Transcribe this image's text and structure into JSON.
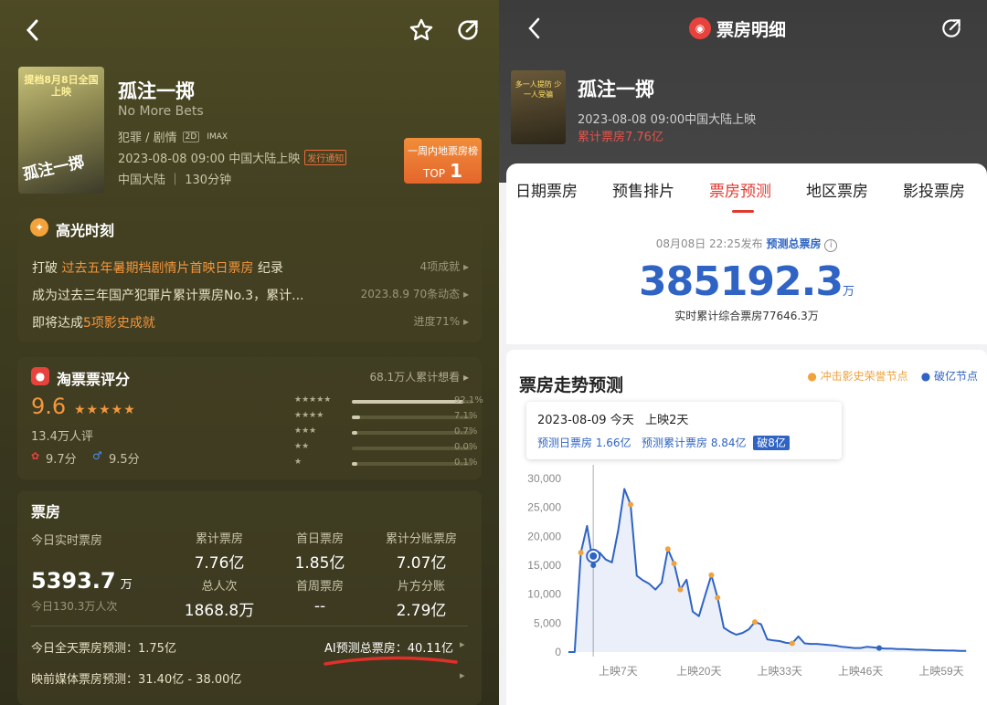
{
  "left": {
    "movie": {
      "title": "孤注一掷",
      "english_title": "No More Bets",
      "genres": "犯罪 / 剧情",
      "format_2d": "2D",
      "format_imax": "IMAX",
      "release": "2023-08-08 09:00 中国大陆上映",
      "release_notice": "发行通知",
      "region_duration": "中国大陆 ｜ 130分钟",
      "poster_text": "提档8月8日全国上映",
      "poster_title": "孤注一掷"
    },
    "rank_badge": {
      "line1": "一周内地票房榜",
      "prefix": "TOP",
      "rank": "1"
    },
    "highlights": {
      "title": "高光时刻",
      "rows": [
        {
          "pre": "打破 ",
          "highlight": "过去五年暑期档剧情片首映日票房",
          "post": " 纪录",
          "right": "4项成就 ▸"
        },
        {
          "pre": "成为过去三年国产犯罪片累计票房No.3，累计...",
          "highlight": "",
          "post": "",
          "right": "2023.8.9 70条动态 ▸"
        },
        {
          "pre": "即将达成",
          "highlight": "5项影史成就",
          "post": "",
          "right": "进度71% ▸"
        }
      ]
    },
    "rating": {
      "title": "淘票票评分",
      "want": "68.1万人累计想看 ▸",
      "score": "9.6",
      "stars": "★★★★★",
      "count": "13.4万人评",
      "sub_rating_1": "9.7分",
      "sub_rating_2": "9.5分",
      "distribution": [
        {
          "stars": "★★★★★",
          "pct": 92.1,
          "label": "92.1%"
        },
        {
          "stars": "★★★★",
          "pct": 7.1,
          "label": "7.1%"
        },
        {
          "stars": "★★★",
          "pct": 0.7,
          "label": "0.7%"
        },
        {
          "stars": "★★",
          "pct": 0.0,
          "label": "0.0%"
        },
        {
          "stars": "★",
          "pct": 0.1,
          "label": "0.1%"
        }
      ]
    },
    "boxoffice": {
      "title": "票房",
      "realtime_label": "今日实时票房",
      "realtime_value": "5393.7",
      "realtime_unit": "万",
      "realtime_people": "今日130.3万人次",
      "cells": [
        {
          "label": "累计票房",
          "value": "7.76亿"
        },
        {
          "label": "首日票房",
          "value": "1.85亿"
        },
        {
          "label": "累计分账票房",
          "value": "7.07亿"
        },
        {
          "label": "总人次",
          "value": "1868.8万"
        },
        {
          "label": "首周票房",
          "value": "--"
        },
        {
          "label": "片方分账",
          "value": "2.79亿"
        }
      ],
      "today_pred": "今日全天票房预测：1.75亿",
      "ai_pred": "AI预测总票房：40.11亿",
      "media_pred": "映前媒体票房预测：31.40亿 - 38.00亿"
    }
  },
  "right": {
    "header_title": "票房明细",
    "movie": {
      "title": "孤注一掷",
      "release": "2023-08-08 09:00中国大陆上映",
      "cumulative": "累计票房7.76亿",
      "poster_text": "多一人提防 少一人受骗"
    },
    "tabs": [
      "日期票房",
      "预售排片",
      "票房预测",
      "地区票房",
      "影投票房"
    ],
    "active_tab": 2,
    "prediction": {
      "published": "08月08日 22:25发布",
      "label": "预测总票房",
      "value": "385192.3",
      "unit": "万",
      "realtime": "实时累计综合票房77646.3万"
    },
    "chart_title": "票房走势预测",
    "legend": [
      {
        "name": "冲击影史荣誉节点",
        "color": "#f0a23c"
      },
      {
        "name": "破亿节点",
        "color": "#2f64c4"
      }
    ],
    "tooltip": {
      "date": "2023-08-09",
      "day": "今天",
      "days_shown": "上映2天",
      "daily": "预测日票房 1.66亿",
      "cumulative": "预测累计票房 8.84亿",
      "badge": "破8亿"
    }
  },
  "chart_data": {
    "type": "line",
    "title": "票房走势预测",
    "ylim": [
      0,
      30000
    ],
    "yticks": [
      0,
      5000,
      10000,
      15000,
      20000,
      25000,
      30000
    ],
    "ytick_labels": [
      "0",
      "5,000",
      "10,000",
      "15,000",
      "20,000",
      "25,000",
      "30,000"
    ],
    "xlim": [
      -1,
      64
    ],
    "xticks": [
      7,
      20,
      33,
      46,
      59
    ],
    "xtick_labels": [
      "上映7天",
      "上映20天",
      "上映33天",
      "上映46天",
      "上映59天"
    ],
    "grid": false,
    "series": [
      {
        "x": [
          -1,
          0,
          1,
          2,
          3,
          4,
          5,
          6,
          7,
          8,
          9,
          10,
          11,
          12,
          13,
          14,
          15,
          16,
          17,
          18,
          19,
          20,
          21,
          22,
          23,
          24,
          25,
          26,
          27,
          28,
          29,
          30,
          31,
          32,
          33,
          34,
          35,
          36,
          37,
          38,
          39,
          40,
          41,
          42,
          43,
          44,
          45,
          46,
          47,
          48,
          49,
          50,
          51,
          52,
          53,
          54,
          55,
          56,
          57,
          58,
          59,
          60,
          61,
          62,
          63
        ],
        "y": [
          0,
          0,
          17200,
          21800,
          15000,
          17200,
          16000,
          15500,
          21000,
          28200,
          25500,
          13200,
          12400,
          11800,
          10800,
          12000,
          17800,
          15300,
          10800,
          12500,
          7000,
          6200,
          9800,
          13300,
          9400,
          4200,
          3500,
          3000,
          3300,
          3900,
          5200,
          4800,
          2200,
          2000,
          1900,
          1600,
          1500,
          2700,
          1500,
          1400,
          1400,
          1300,
          1200,
          1100,
          900,
          800,
          700,
          700,
          900,
          800,
          700,
          600,
          600,
          500,
          500,
          450,
          400,
          400,
          350,
          300,
          300,
          250,
          250,
          200,
          200
        ]
      }
    ],
    "highlight_x": 3,
    "highlight_y": 16600,
    "honor_points_x": [
      1,
      9,
      15,
      16,
      17,
      22,
      23,
      29,
      35,
      49
    ],
    "yi_points_x": [
      3,
      49
    ]
  }
}
